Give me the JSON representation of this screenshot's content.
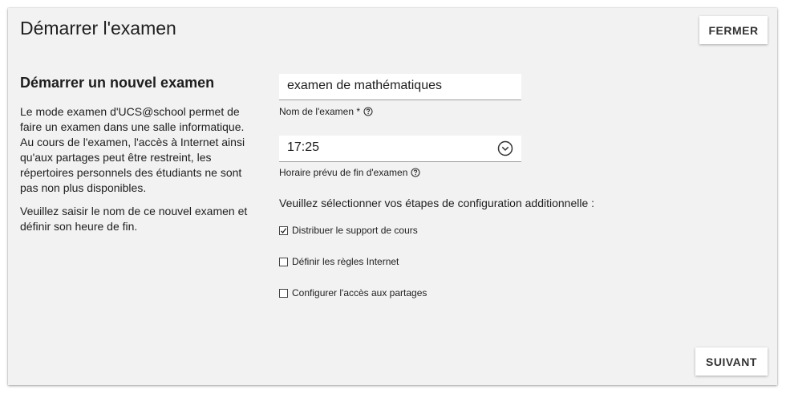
{
  "dialog": {
    "title": "Démarrer l'examen",
    "close_label": "FERMER",
    "next_label": "SUIVANT"
  },
  "intro": {
    "title": "Démarrer un nouvel examen",
    "paragraph_1": "Le mode examen d'UCS@school permet de faire un examen dans une salle informatique. Au cours de l'examen, l'accès à Internet ainsi qu'aux partages peut être restreint, les répertoires personnels des étudiants ne sont pas non plus disponibles.",
    "paragraph_2": "Veuillez saisir le nom de ce nouvel examen et définir son heure de fin."
  },
  "form": {
    "exam_name": {
      "value": "examen de mathématiques",
      "label": "Nom de l'examen *"
    },
    "end_time": {
      "value": "17:25",
      "label": "Horaire prévu de fin d'examen"
    },
    "steps_heading": "Veuillez sélectionner vos étapes de configuration additionnelle :",
    "steps": [
      {
        "label": "Distribuer le support de cours",
        "checked": true
      },
      {
        "label": "Définir les règles Internet",
        "checked": false
      },
      {
        "label": "Configurer l'accès aux partages",
        "checked": false
      }
    ]
  },
  "icons": {
    "help": "help-circle-icon",
    "time": "clock-chevron-icon",
    "check": "checkmark-icon"
  }
}
